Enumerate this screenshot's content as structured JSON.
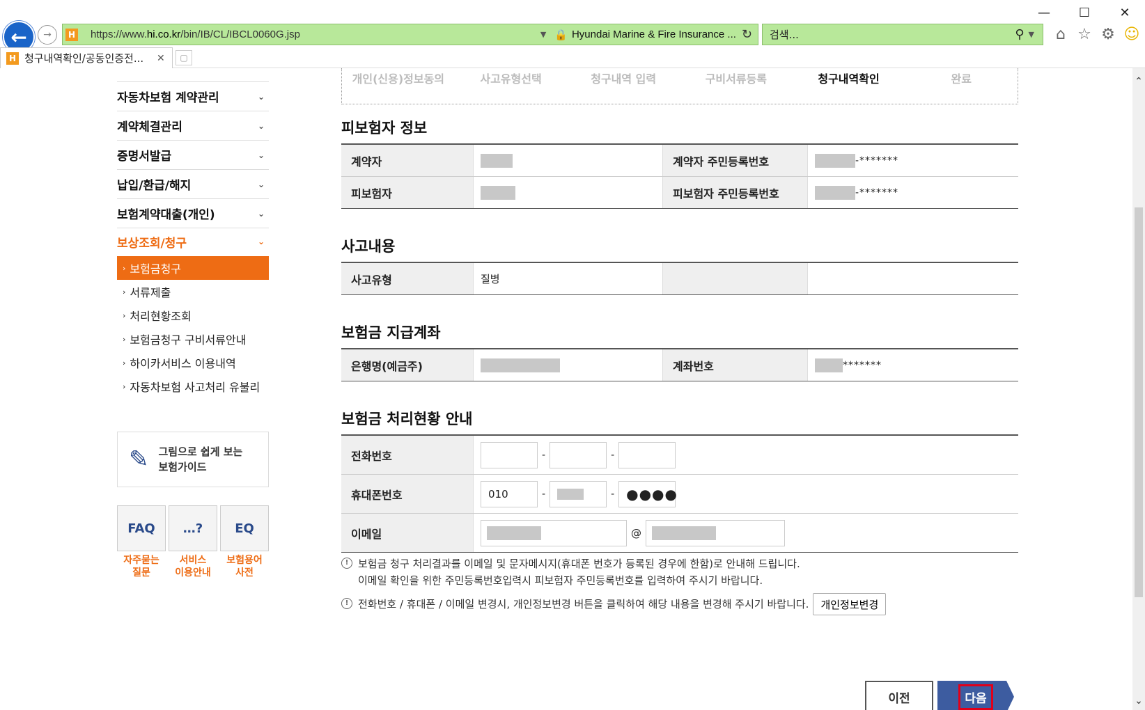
{
  "browser": {
    "url_prefix": "https://www.",
    "url_host": "hi.co.kr",
    "url_path": "/bin/IB/CL/IBCL0060G.jsp",
    "cert_name": "Hyundai Marine & Fire Insurance ...",
    "search_placeholder": "검색...",
    "tab_title": "청구내역확인/공동인증전...",
    "site_icon_letter": "H"
  },
  "sidebar": {
    "menu": [
      "자동차보험 계약관리",
      "계약체결관리",
      "증명서발급",
      "납입/환급/해지",
      "보험계약대출(개인)",
      "보상조회/청구"
    ],
    "sub_active": "보험금청구",
    "sub_items": [
      "서류제출",
      "처리현황조회",
      "보험금청구 구비서류안내",
      "하이카서비스 이용내역",
      "자동차보험 사고처리 유불리"
    ],
    "guide_line1": "그림으로 쉽게 보는",
    "guide_line2": "보험가이드",
    "quick": [
      {
        "icon": "FAQ",
        "label": "자주묻는\n질문"
      },
      {
        "icon": "…?",
        "label": "서비스\n이용안내"
      },
      {
        "icon": "EQ",
        "label": "보험용어\n사전"
      }
    ]
  },
  "steps": [
    "개인(신용)정보동의",
    "사고유형선택",
    "청구내역 입력",
    "구비서류등록",
    "청구내역확인",
    "완료"
  ],
  "insured": {
    "title": "피보험자 정보",
    "contractor_label": "계약자",
    "contractor_ssn_label": "계약자 주민등록번호",
    "insured_label": "피보험자",
    "insured_ssn_label": "피보험자 주민등록번호",
    "ssn_mask": "-*******"
  },
  "accident": {
    "title": "사고내용",
    "type_label": "사고유형",
    "type_value": "질병"
  },
  "account": {
    "title": "보험금 지급계좌",
    "bank_label": "은행명(예금주)",
    "number_label": "계좌번호",
    "number_mask": "*******"
  },
  "status": {
    "title": "보험금 처리현황 안내",
    "phone_label": "전화번호",
    "mobile_label": "휴대폰번호",
    "mobile_prefix": "010",
    "mobile_last": "●●●●",
    "email_label": "이메일",
    "dash": "-",
    "at": "@"
  },
  "notes": {
    "note1_line1": "보험금 청구 처리결과를 이메일 및 문자메시지(휴대폰 번호가 등록된 경우에 한함)로 안내해 드립니다.",
    "note1_line2": "이메일 확인을 위한 주민등록번호입력시 피보험자 주민등록번호를 입력하여 주시기 바랍니다.",
    "note2": "전화번호 / 휴대폰 / 이메일 변경시, 개인정보변경 버튼을 클릭하여 해당 내용을 변경해 주시기 바랍니다.",
    "change_button": "개인정보변경"
  },
  "buttons": {
    "prev": "이전",
    "next": "다음"
  }
}
